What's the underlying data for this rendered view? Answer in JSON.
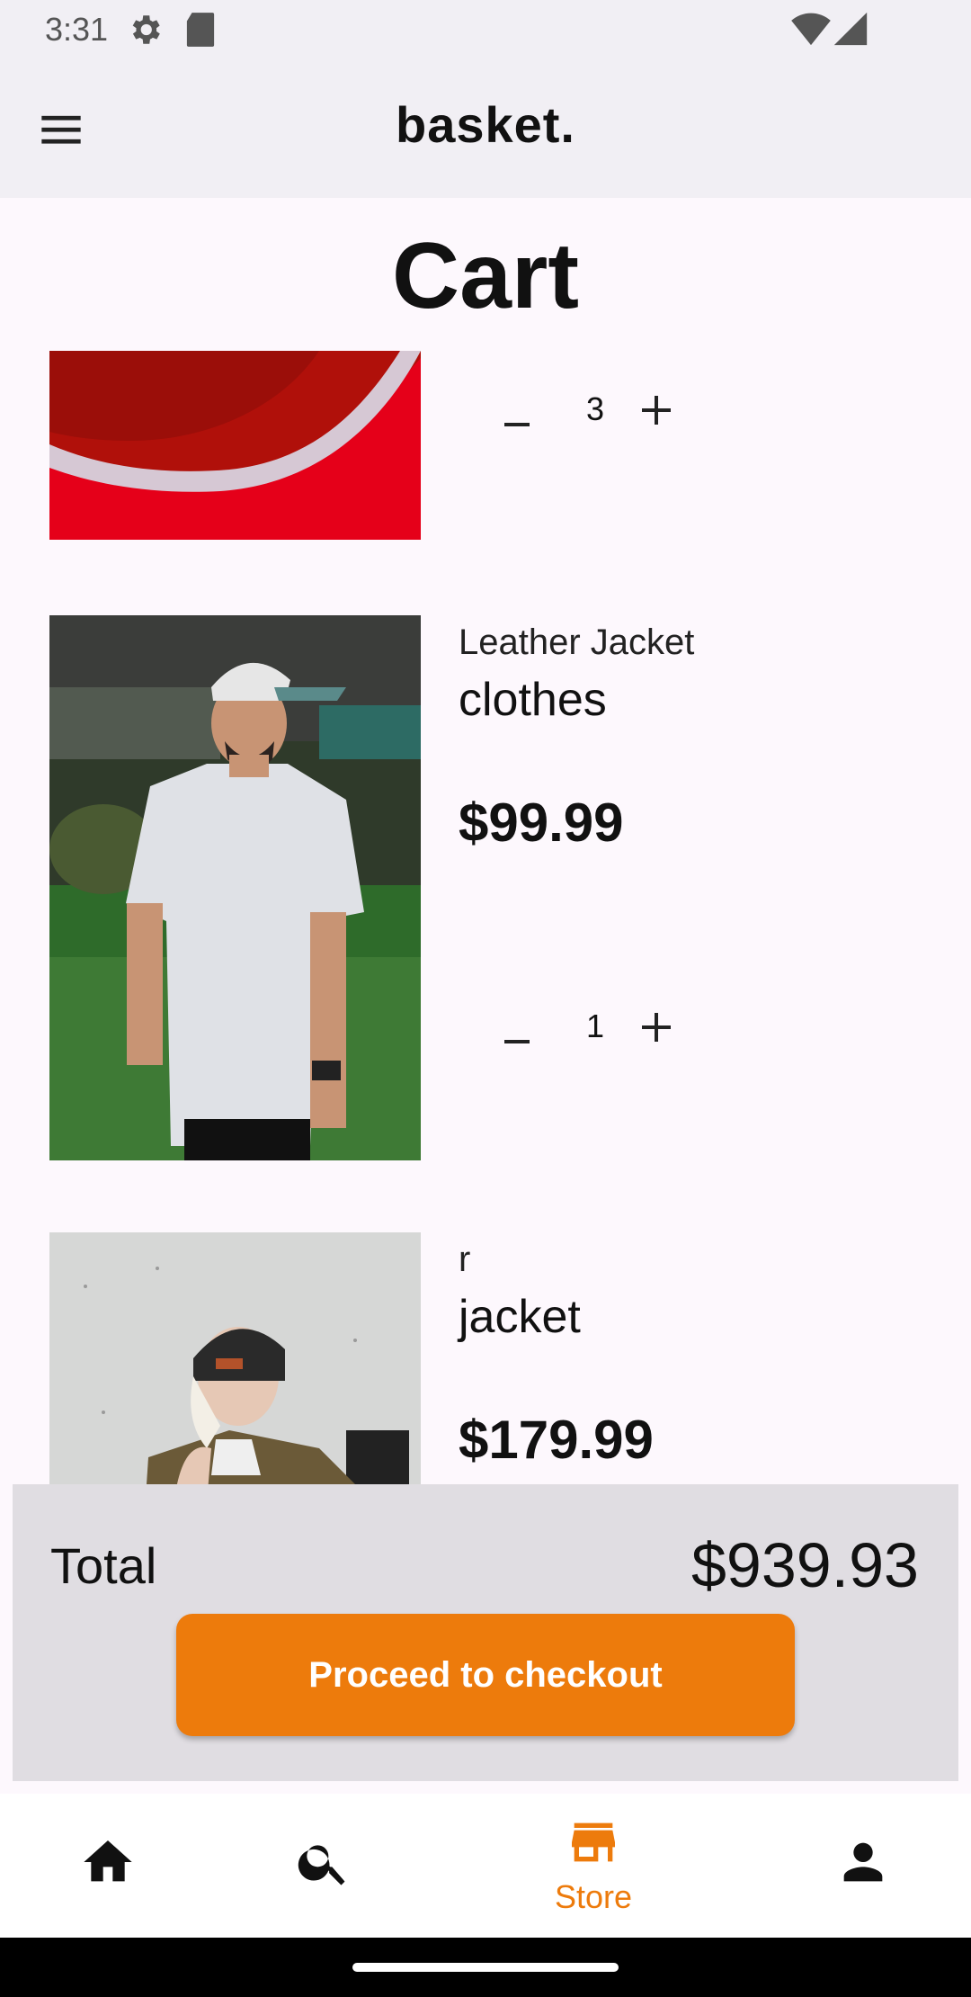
{
  "status_bar": {
    "time": "3:31",
    "icons": [
      "settings-gear-icon",
      "sd-card-icon",
      "wifi-icon",
      "cell-signal-icon"
    ]
  },
  "app_bar": {
    "brand": "basket.",
    "menu_icon": "hamburger-menu-icon"
  },
  "page": {
    "title": "Cart"
  },
  "cart": {
    "items": [
      {
        "name": "",
        "category": "",
        "price": "",
        "quantity": "3",
        "image": "red-sneaker-photo"
      },
      {
        "name": "Leather Jacket",
        "category": "clothes",
        "price": "$99.99",
        "quantity": "1",
        "image": "man-white-tshirt-photo"
      },
      {
        "name": "r",
        "category": "jacket",
        "price": "$179.99",
        "quantity": "",
        "image": "woman-beanie-jacket-photo"
      }
    ]
  },
  "summary": {
    "total_label": "Total",
    "total_value": "$939.93",
    "checkout_label": "Proceed to checkout"
  },
  "bottom_nav": {
    "items": [
      {
        "icon": "home-icon",
        "label": ""
      },
      {
        "icon": "search-icon",
        "label": ""
      },
      {
        "icon": "store-icon",
        "label": "Store",
        "active": true
      },
      {
        "icon": "person-icon",
        "label": ""
      }
    ],
    "active_color": "#ed7b0c"
  },
  "colors": {
    "accent": "#ed7b0c",
    "app_bar_bg": "#f1eff4",
    "total_panel_bg": "#e0dde2"
  }
}
